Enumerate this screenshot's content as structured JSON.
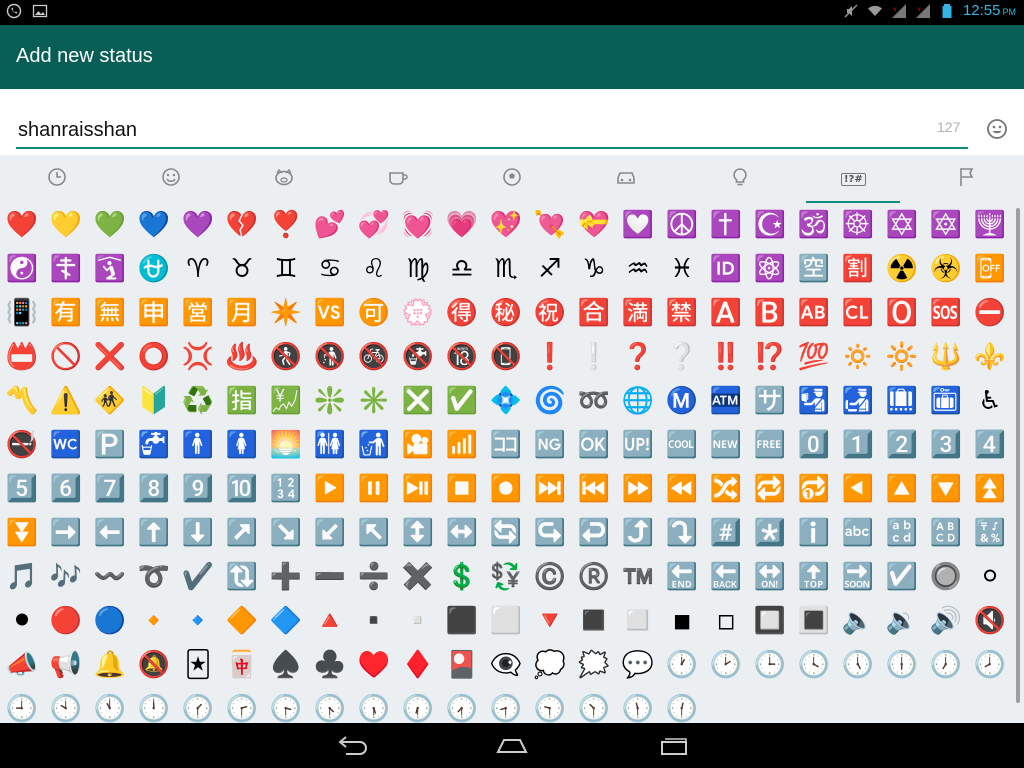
{
  "status_bar": {
    "time": "12:55",
    "ampm": "PM",
    "left_icons": [
      "whatsapp-icon",
      "image-icon"
    ],
    "right_icons": [
      "mute-icon",
      "wifi-icon",
      "signal-icon",
      "signal-icon",
      "battery-icon"
    ]
  },
  "app_bar": {
    "title": "Add new status"
  },
  "status_input": {
    "value": "shanraisshan",
    "char_count": "127"
  },
  "tabs": [
    {
      "name": "recent",
      "icon": "clock-icon",
      "active": false
    },
    {
      "name": "smileys",
      "icon": "smiley-icon",
      "active": false
    },
    {
      "name": "animals",
      "icon": "pig-icon",
      "active": false
    },
    {
      "name": "food",
      "icon": "cup-icon",
      "active": false
    },
    {
      "name": "activity",
      "icon": "soccer-ball-icon",
      "active": false
    },
    {
      "name": "travel",
      "icon": "car-icon",
      "active": false
    },
    {
      "name": "objects",
      "icon": "lightbulb-icon",
      "active": false
    },
    {
      "name": "symbols",
      "icon": "symbols-icon",
      "label": "!?#",
      "active": true
    },
    {
      "name": "flags",
      "icon": "flag-icon",
      "active": false
    }
  ],
  "emoji_rows": [
    [
      "❤️",
      "💛",
      "💚",
      "💙",
      "💜",
      "💔",
      "❣️",
      "💕",
      "💞",
      "💓",
      "💗",
      "💖",
      "💘",
      "💝",
      "💟",
      "☮️",
      "✝️",
      "☪️",
      "🕉️",
      "☸️",
      "✡️",
      "🔯",
      "🕎"
    ],
    [
      "☯️",
      "☦️",
      "🛐",
      "⛎",
      "♈",
      "♉",
      "♊",
      "♋",
      "♌",
      "♍",
      "♎",
      "♏",
      "♐",
      "♑",
      "♒",
      "♓",
      "🆔",
      "⚛️",
      "🈳",
      "🈹",
      "☢️",
      "☣️",
      "📴"
    ],
    [
      "📳",
      "🈶",
      "🈚",
      "🈸",
      "🈺",
      "🈷️",
      "✴️",
      "🆚",
      "🉑",
      "💮",
      "🉐",
      "㊙️",
      "㊗️",
      "🈴",
      "🈵",
      "🈲",
      "🅰️",
      "🅱️",
      "🆎",
      "🆑",
      "🅾️",
      "🆘",
      "⛔"
    ],
    [
      "📛",
      "🚫",
      "❌",
      "⭕",
      "💢",
      "♨️",
      "🚷",
      "🚯",
      "🚳",
      "🚱",
      "🔞",
      "📵",
      "❗",
      "❕",
      "❓",
      "❔",
      "‼️",
      "⁉️",
      "💯",
      "🔅",
      "🔆",
      "🔱",
      "⚜️"
    ],
    [
      "〽️",
      "⚠️",
      "🚸",
      "🔰",
      "♻️",
      "🈯",
      "💹",
      "❇️",
      "✳️",
      "❎",
      "✅",
      "💠",
      "🌀",
      "➿",
      "🌐",
      "Ⓜ️",
      "🏧",
      "🈂️",
      "🛂",
      "🛃",
      "🛄",
      "🛅",
      "♿"
    ],
    [
      "🚭",
      "🚾",
      "🅿️",
      "🚰",
      "🚹",
      "🚺",
      "🌅",
      "🚻",
      "🚮",
      "🎦",
      "📶",
      "🈁",
      "🆖",
      "🆗",
      "🆙",
      "🆒",
      "🆕",
      "🆓",
      "0️⃣",
      "1️⃣",
      "2️⃣",
      "3️⃣",
      "4️⃣"
    ],
    [
      "5️⃣",
      "6️⃣",
      "7️⃣",
      "8️⃣",
      "9️⃣",
      "🔟",
      "🔢",
      "▶️",
      "⏸️",
      "⏯️",
      "⏹️",
      "⏺️",
      "⏭️",
      "⏮️",
      "⏩",
      "⏪",
      "🔀",
      "🔁",
      "🔂",
      "◀️",
      "🔼",
      "🔽",
      "⏫"
    ],
    [
      "⏬",
      "➡️",
      "⬅️",
      "⬆️",
      "⬇️",
      "↗️",
      "↘️",
      "↙️",
      "↖️",
      "↕️",
      "↔️",
      "🔄",
      "↪️",
      "↩️",
      "⤴️",
      "⤵️",
      "#️⃣",
      "*️⃣",
      "ℹ️",
      "🔤",
      "🔡",
      "🔠",
      "🔣"
    ],
    [
      "🎵",
      "🎶",
      "〰️",
      "➰",
      "✔️",
      "🔃",
      "➕",
      "➖",
      "➗",
      "✖️",
      "💲",
      "💱",
      "©️",
      "®️",
      "™️",
      "🔚",
      "🔙",
      "🔛",
      "🔝",
      "🔜",
      "☑️",
      "🔘",
      "⚪"
    ],
    [
      "⚫",
      "🔴",
      "🔵",
      "🔸",
      "🔹",
      "🔶",
      "🔷",
      "🔺",
      "▪️",
      "▫️",
      "⬛",
      "⬜",
      "🔻",
      "◼️",
      "◻️",
      "◾",
      "◽",
      "🔲",
      "🔳",
      "🔈",
      "🔉",
      "🔊",
      "🔇"
    ],
    [
      "📣",
      "📢",
      "🔔",
      "🔕",
      "🃏",
      "🀄",
      "♠️",
      "♣️",
      "♥️",
      "♦️",
      "🎴",
      "👁️‍🗨️",
      "💭",
      "🗯️",
      "💬",
      "🕐",
      "🕑",
      "🕒",
      "🕓",
      "🕔",
      "🕕",
      "🕖",
      "🕗"
    ],
    [
      "🕘",
      "🕙",
      "🕚",
      "🕛",
      "🕜",
      "🕝",
      "🕞",
      "🕟",
      "🕠",
      "🕡",
      "🕢",
      "🕣",
      "🕤",
      "🕥",
      "🕦",
      "🕧"
    ]
  ]
}
